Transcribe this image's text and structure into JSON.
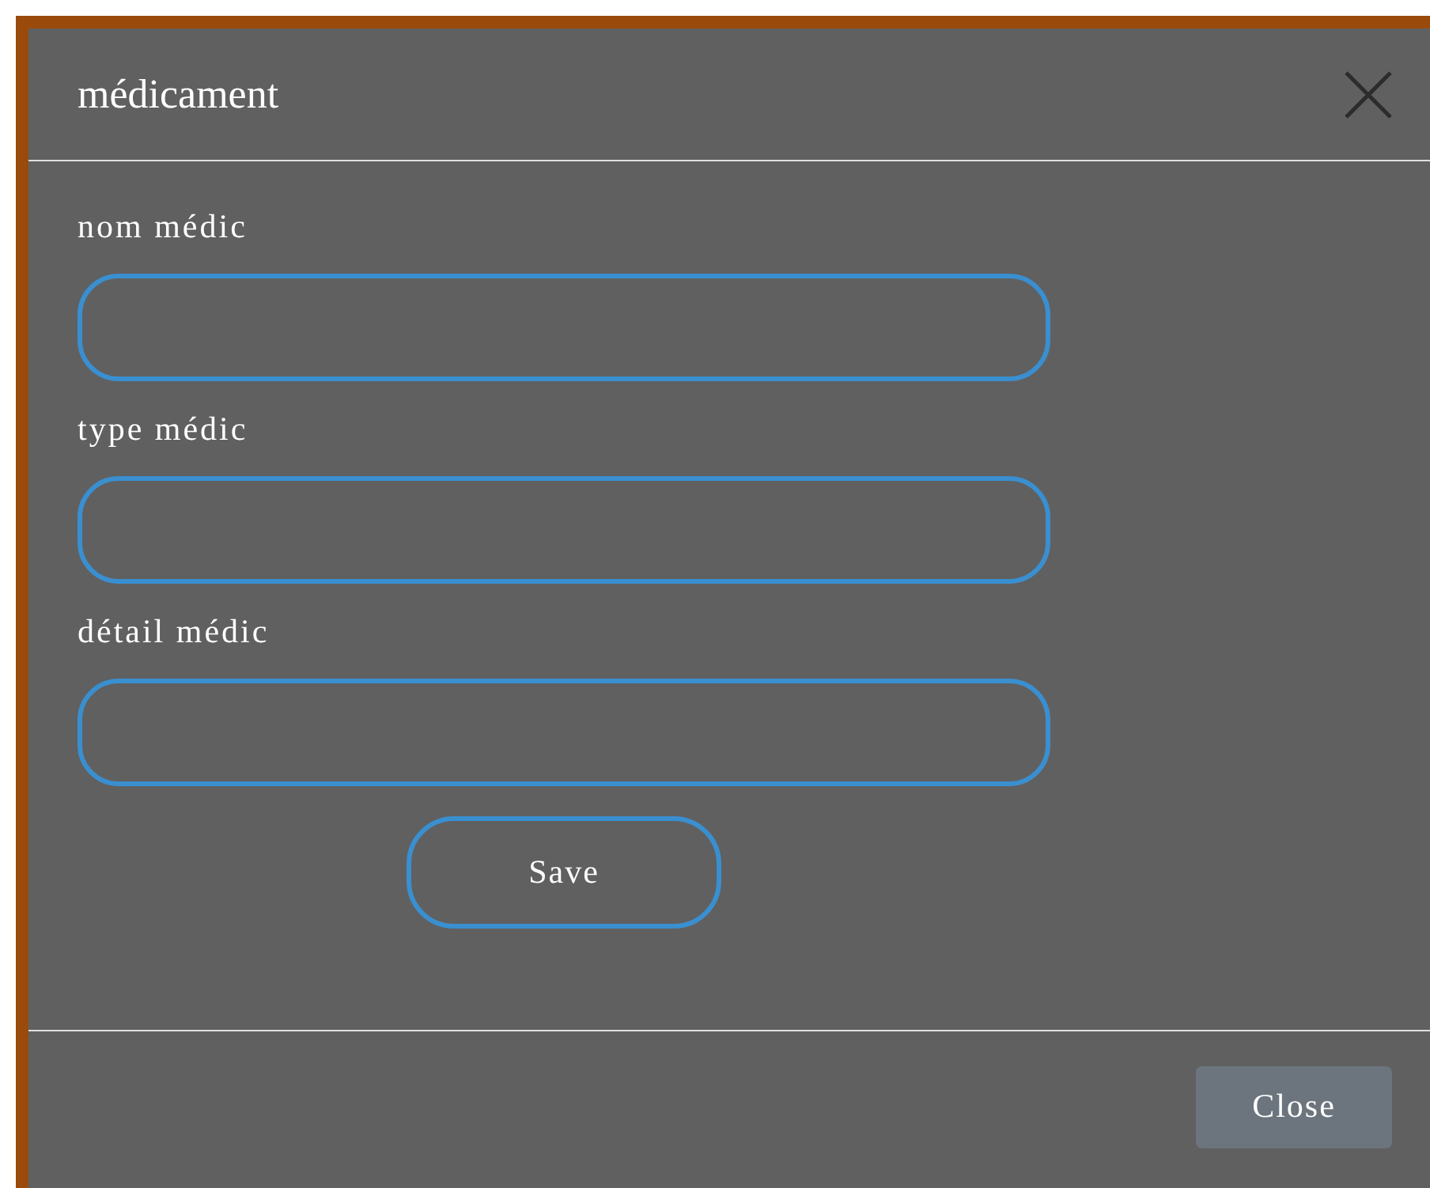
{
  "dialog": {
    "title": "médicament",
    "fields": [
      {
        "label": "nom médic"
      },
      {
        "label": "type médic"
      },
      {
        "label": "détail médic"
      }
    ],
    "save_button": "Save",
    "close_button": "Close"
  }
}
